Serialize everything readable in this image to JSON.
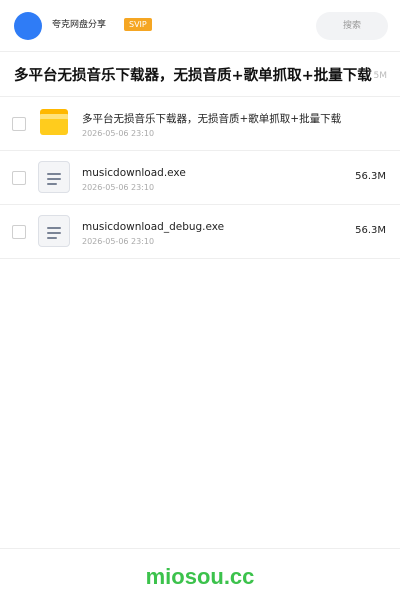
{
  "header": {
    "username": "夸克网盘分享",
    "badge": "SVIP",
    "search_label": "搜索",
    "avatar_color": "#2f7cf6"
  },
  "share": {
    "title": "多平台无损音乐下载器，无损音质+歌单抓取+批量下载",
    "size": "5M"
  },
  "files": [
    {
      "icon": "folder-icon",
      "name": "多平台无损音乐下载器，无损音质+歌单抓取+批量下载",
      "date": "2026-05-06 23:10",
      "size": ""
    },
    {
      "icon": "file-icon",
      "name": "musicdownload.exe",
      "date": "2026-05-06 23:10",
      "size": "56.3M"
    },
    {
      "icon": "file-icon",
      "name": "musicdownload_debug.exe",
      "date": "2026-05-06 23:10",
      "size": "56.3M"
    }
  ],
  "footer": {
    "brand": "miosou.cc",
    "brand_color": "#3cc24c"
  }
}
